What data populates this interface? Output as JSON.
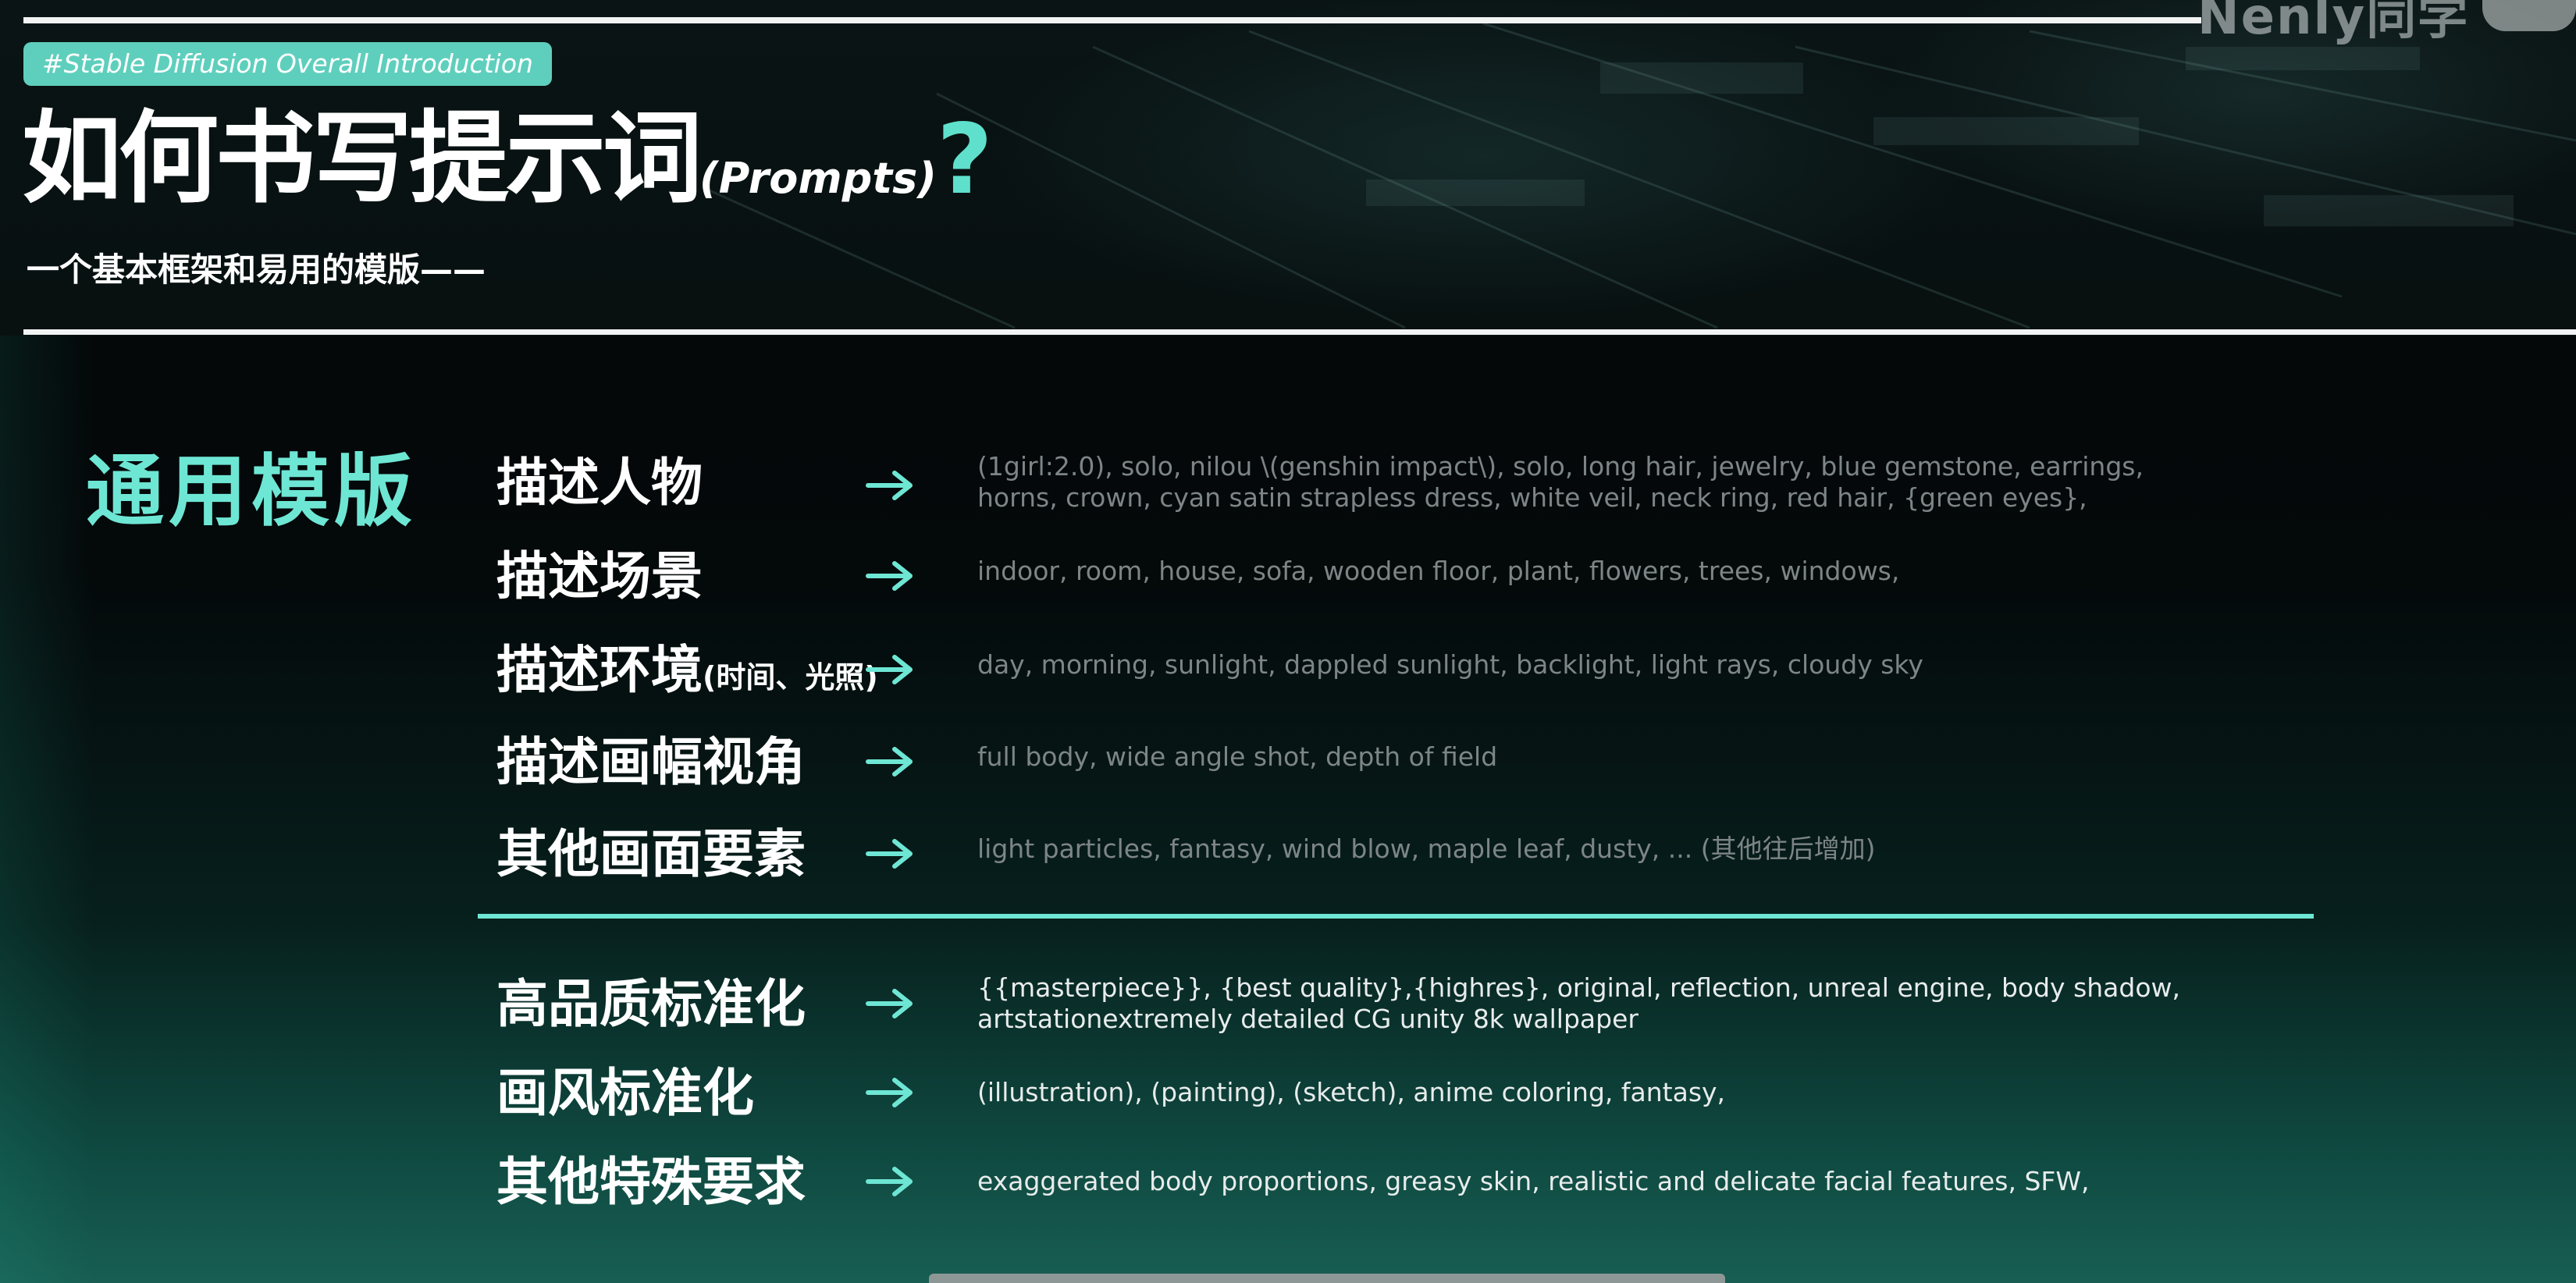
{
  "header": {
    "hashtag": "#Stable Diffusion Overall Introduction",
    "title_main": "如何书写提示词",
    "title_paren": "(Prompts)",
    "title_question": "?",
    "subtitle": "一个基本框架和易用的模版——",
    "watermark": "Nenly同学"
  },
  "section": {
    "title": "通用模版"
  },
  "rows_top": [
    {
      "label": "描述人物",
      "note": "",
      "lines": [
        "(1girl:2.0), solo, nilou \\(genshin impact\\), solo, long hair, jewelry, blue gemstone, earrings,",
        "horns, crown, cyan satin strapless dress, white veil, neck ring, red hair, {green eyes},"
      ]
    },
    {
      "label": "描述场景",
      "note": "",
      "lines": [
        "indoor, room, house, sofa, wooden floor, plant, flowers, trees, windows,"
      ]
    },
    {
      "label": "描述环境",
      "note": "(时间、光照)",
      "lines": [
        "day, morning, sunlight, dappled sunlight, backlight, light rays, cloudy sky"
      ]
    },
    {
      "label": "描述画幅视角",
      "note": "",
      "lines": [
        "full body, wide angle shot, depth of field"
      ]
    },
    {
      "label": "其他画面要素",
      "note": "",
      "lines": [
        "light particles, fantasy, wind blow, maple leaf, dusty, ... (其他往后增加)"
      ]
    }
  ],
  "rows_bottom": [
    {
      "label": "高品质标准化",
      "lines": [
        "{{masterpiece}}, {best quality},{highres}, original, reflection, unreal engine, body shadow,",
        "artstationextremely detailed CG unity 8k wallpaper"
      ]
    },
    {
      "label": "画风标准化",
      "lines": [
        "(illustration), (painting), (sketch), anime coloring, fantasy,"
      ]
    },
    {
      "label": "其他特殊要求",
      "lines": [
        "exaggerated body proportions, greasy skin, realistic and delicate facial features, SFW,"
      ]
    }
  ],
  "icons": {
    "arrow": "arrow-right-icon"
  },
  "colors": {
    "accent": "#6ee6d4",
    "badge": "#5fcfbd",
    "text_dim": "#7d8586",
    "text_bright": "#e8ecec"
  }
}
